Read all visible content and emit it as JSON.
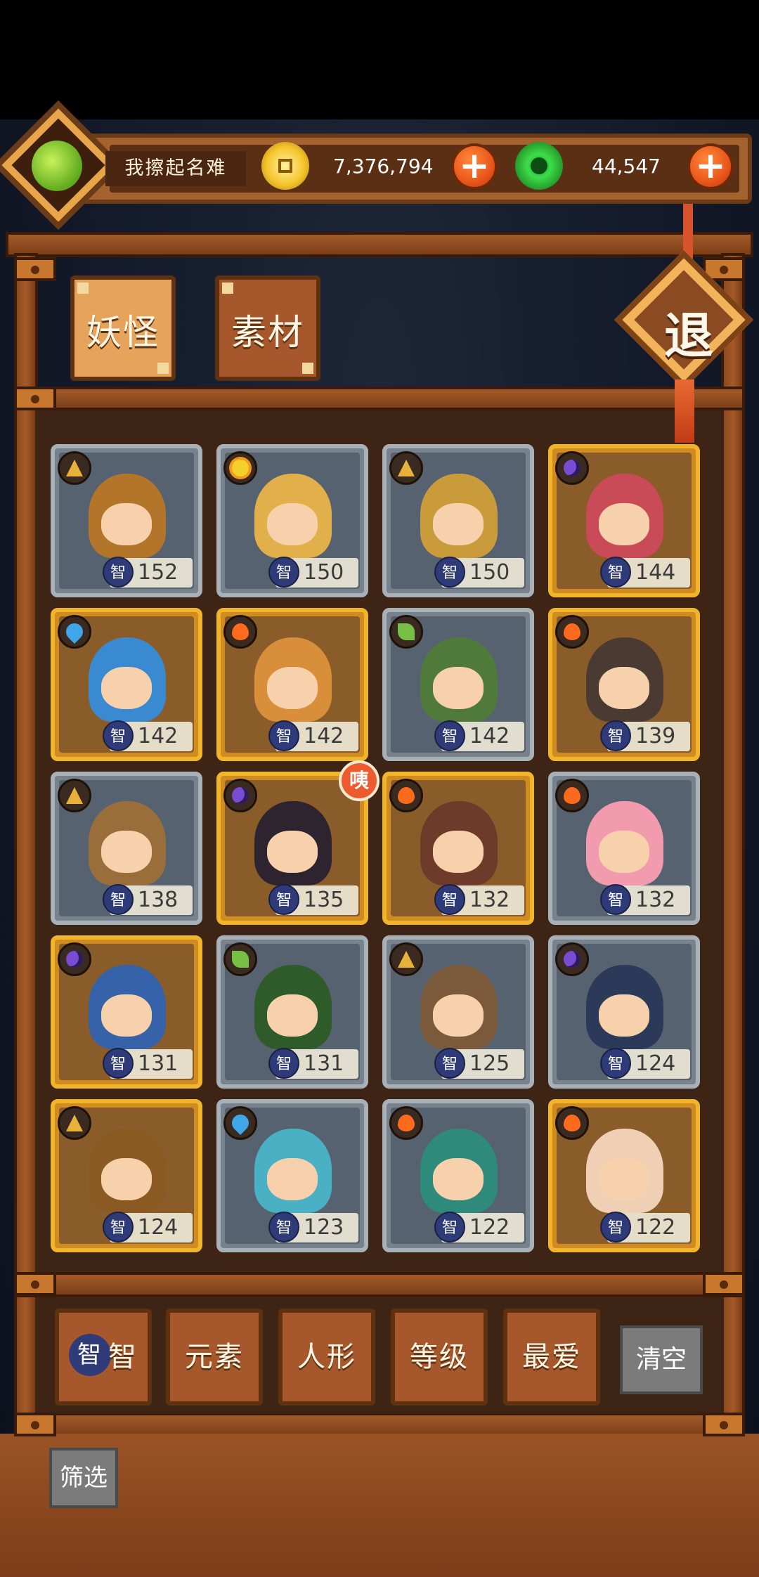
{
  "profile": {
    "name": "我擦起名难"
  },
  "currency": {
    "gold": {
      "amount": "7,376,794",
      "add_label": "+"
    },
    "jade": {
      "amount": "44,547",
      "add_label": "+"
    }
  },
  "tabs": [
    {
      "label": "妖怪",
      "active": true
    },
    {
      "label": "素材",
      "active": false
    }
  ],
  "exit_label": "退",
  "creatures": [
    {
      "element": "earth",
      "rarity": "silver",
      "stat_icon": "智",
      "value": "152",
      "color": "#b3752a"
    },
    {
      "element": "sun",
      "rarity": "silver",
      "stat_icon": "智",
      "value": "150",
      "color": "#e2b04a"
    },
    {
      "element": "earth",
      "rarity": "silver",
      "stat_icon": "智",
      "value": "150",
      "color": "#c99b3a"
    },
    {
      "element": "moon",
      "rarity": "gold",
      "stat_icon": "智",
      "value": "144",
      "color": "#c94b57"
    },
    {
      "element": "water",
      "rarity": "gold",
      "stat_icon": "智",
      "value": "142",
      "color": "#3a8ad2"
    },
    {
      "element": "fire",
      "rarity": "gold",
      "stat_icon": "智",
      "value": "142",
      "color": "#d98e3a"
    },
    {
      "element": "wood",
      "rarity": "silver",
      "stat_icon": "智",
      "value": "142",
      "color": "#4f7a3a"
    },
    {
      "element": "fire",
      "rarity": "gold",
      "stat_icon": "智",
      "value": "139",
      "color": "#4a3a32"
    },
    {
      "element": "earth",
      "rarity": "silver",
      "stat_icon": "智",
      "value": "138",
      "color": "#9a6e3a"
    },
    {
      "element": "moon",
      "rarity": "gold",
      "stat_icon": "智",
      "value": "135",
      "color": "#2e2430",
      "new": "咦"
    },
    {
      "element": "fire",
      "rarity": "gold",
      "stat_icon": "智",
      "value": "132",
      "color": "#6e3a2a"
    },
    {
      "element": "fire",
      "rarity": "silver",
      "stat_icon": "智",
      "value": "132",
      "color": "#f29aae"
    },
    {
      "element": "moon",
      "rarity": "gold",
      "stat_icon": "智",
      "value": "131",
      "color": "#3562a8"
    },
    {
      "element": "wood",
      "rarity": "silver",
      "stat_icon": "智",
      "value": "131",
      "color": "#2f5a2a"
    },
    {
      "element": "earth",
      "rarity": "silver",
      "stat_icon": "智",
      "value": "125",
      "color": "#7a5a3a"
    },
    {
      "element": "moon",
      "rarity": "silver",
      "stat_icon": "智",
      "value": "124",
      "color": "#2c3a5a"
    },
    {
      "element": "earth",
      "rarity": "gold",
      "stat_icon": "智",
      "value": "124",
      "color": "#8a5a22"
    },
    {
      "element": "water",
      "rarity": "silver",
      "stat_icon": "智",
      "value": "123",
      "color": "#4ab0c4"
    },
    {
      "element": "fire",
      "rarity": "silver",
      "stat_icon": "智",
      "value": "122",
      "color": "#2e8a7a"
    },
    {
      "element": "fire",
      "rarity": "gold",
      "stat_icon": "智",
      "value": "122",
      "color": "#f0d0b4"
    }
  ],
  "filters": {
    "sort_icon": "智",
    "items": [
      {
        "label": "智"
      },
      {
        "label": "元素"
      },
      {
        "label": "人形"
      },
      {
        "label": "等级"
      },
      {
        "label": "最爱"
      }
    ],
    "clear_label": "清空",
    "sift_label": "筛选"
  }
}
